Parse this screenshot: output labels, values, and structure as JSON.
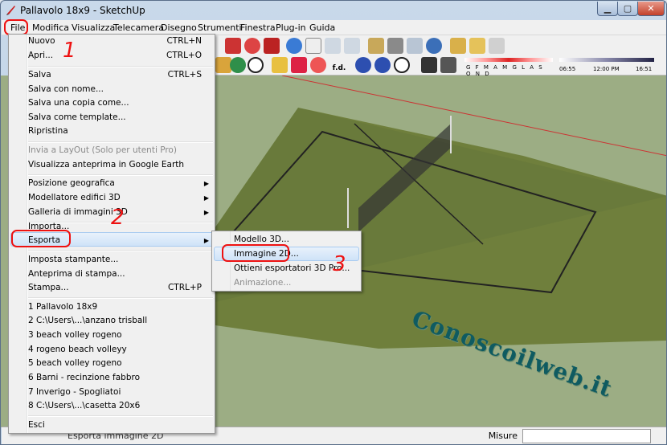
{
  "window": {
    "title": "Pallavolo 18x9 - SketchUp"
  },
  "menubar": {
    "items": [
      "File",
      "Modifica",
      "Visualizza",
      "Telecamera",
      "Disegno",
      "Strumenti",
      "Finestra",
      "Plug-in",
      "Guida"
    ]
  },
  "file_menu": {
    "nuovo": {
      "label": "Nuovo",
      "shortcut": "CTRL+N"
    },
    "apri": {
      "label": "Apri...",
      "shortcut": "CTRL+O"
    },
    "salva": {
      "label": "Salva",
      "shortcut": "CTRL+S"
    },
    "salva_nome": {
      "label": "Salva con nome..."
    },
    "salva_copia": {
      "label": "Salva una copia come..."
    },
    "salva_template": {
      "label": "Salva come template..."
    },
    "ripristina": {
      "label": "Ripristina"
    },
    "layout": {
      "label": "Invia a LayOut (Solo per utenti Pro)"
    },
    "google_earth": {
      "label": "Visualizza anteprima in Google Earth"
    },
    "posizione": {
      "label": "Posizione geografica"
    },
    "modellatore": {
      "label": "Modellatore edifici 3D"
    },
    "galleria": {
      "label": "Galleria di immagini 3D"
    },
    "importa": {
      "label": "Importa..."
    },
    "esporta": {
      "label": "Esporta"
    },
    "imposta_stampante": {
      "label": "Imposta stampante..."
    },
    "anteprima_stampa": {
      "label": "Anteprima di stampa..."
    },
    "stampa": {
      "label": "Stampa...",
      "shortcut": "CTRL+P"
    },
    "recent": [
      "1 Pallavolo 18x9",
      "2 C:\\Users\\...\\anzano trisball",
      "3 beach volley rogeno",
      "4 rogeno beach volleyy",
      "5 beach volley rogeno",
      "6 Barni - recinzione fabbro",
      "7 Inverigo - Spogliatoi",
      "8 C:\\Users\\...\\casetta 20x6"
    ],
    "esci": {
      "label": "Esci"
    }
  },
  "export_submenu": {
    "items": [
      "Modello 3D...",
      "Immagine 2D...",
      "Ottieni esportatori 3D Pro...",
      "Animazione..."
    ]
  },
  "annotations": {
    "n1": "1",
    "n2": "2",
    "n3": "3"
  },
  "toolbar": {
    "fd_label": "f.d.",
    "weather_letters": "G F M A M G L A S O N D",
    "time_start": "06:55",
    "time_mid": "12:00 PM",
    "time_end": "16:51"
  },
  "status": {
    "label": "Misure",
    "tip": "Esporta immagine 2D"
  },
  "watermark": "Conoscoilweb.it",
  "colors": {
    "highlight": "#cfe3f8",
    "annotation": "#ee1111",
    "ground": "#9cad84",
    "court": "#6f7f3c"
  }
}
